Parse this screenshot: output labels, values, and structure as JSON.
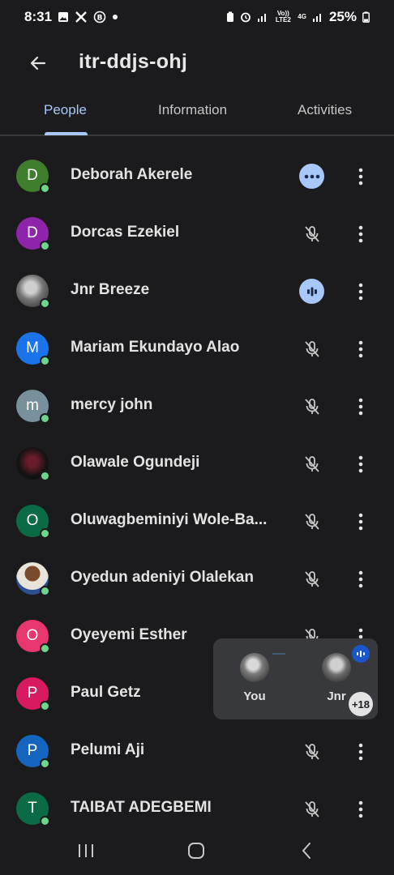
{
  "status_bar": {
    "time": "8:31",
    "battery": "25%",
    "network_volte": "Vo)) LTE2",
    "network_4g": "4G"
  },
  "header": {
    "title": "itr-ddjs-ohj"
  },
  "tabs": [
    {
      "label": "People",
      "active": true
    },
    {
      "label": "Information",
      "active": false
    },
    {
      "label": "Activities",
      "active": false
    }
  ],
  "participants": [
    {
      "initial": "D",
      "name": "Deborah Akerele",
      "avatar_color": "#3f7e2c",
      "photo": false,
      "status": "more-reactions"
    },
    {
      "initial": "D",
      "name": "Dorcas Ezekiel",
      "avatar_color": "#8e24aa",
      "photo": false,
      "status": "muted"
    },
    {
      "initial": "",
      "name": "Jnr Breeze",
      "avatar_color": "#4a4a4a",
      "photo": true,
      "status": "speaking"
    },
    {
      "initial": "M",
      "name": "Mariam Ekundayo Alao",
      "avatar_color": "#1a73e8",
      "photo": false,
      "status": "muted"
    },
    {
      "initial": "m",
      "name": "mercy john",
      "avatar_color": "#78909c",
      "photo": false,
      "status": "muted"
    },
    {
      "initial": "",
      "name": "Olawale Ogundeji",
      "avatar_color": "#111111",
      "photo": true,
      "status": "muted"
    },
    {
      "initial": "O",
      "name": "Oluwagbeminiyi Wole-Ba...",
      "avatar_color": "#0b6b45",
      "photo": false,
      "status": "muted"
    },
    {
      "initial": "",
      "name": "Oyedun adeniyi Olalekan",
      "avatar_color": "#c9a27a",
      "photo": true,
      "status": "muted"
    },
    {
      "initial": "O",
      "name": "Oyeyemi Esther",
      "avatar_color": "#e8366e",
      "photo": false,
      "status": "muted"
    },
    {
      "initial": "P",
      "name": "Paul Getz",
      "avatar_color": "#d81b60",
      "photo": false,
      "status": "muted"
    },
    {
      "initial": "P",
      "name": "Pelumi Aji",
      "avatar_color": "#1565c0",
      "photo": false,
      "status": "muted"
    },
    {
      "initial": "T",
      "name": "TAIBAT ADEGBEMI",
      "avatar_color": "#0b6b45",
      "photo": false,
      "status": "muted"
    }
  ],
  "pip": {
    "you_label": "You",
    "other_label": "Jnr",
    "extra_count": "+18"
  },
  "colors": {
    "accent": "#a8c7fa",
    "online_dot": "#6dd58c",
    "background": "#1b1b1d"
  }
}
